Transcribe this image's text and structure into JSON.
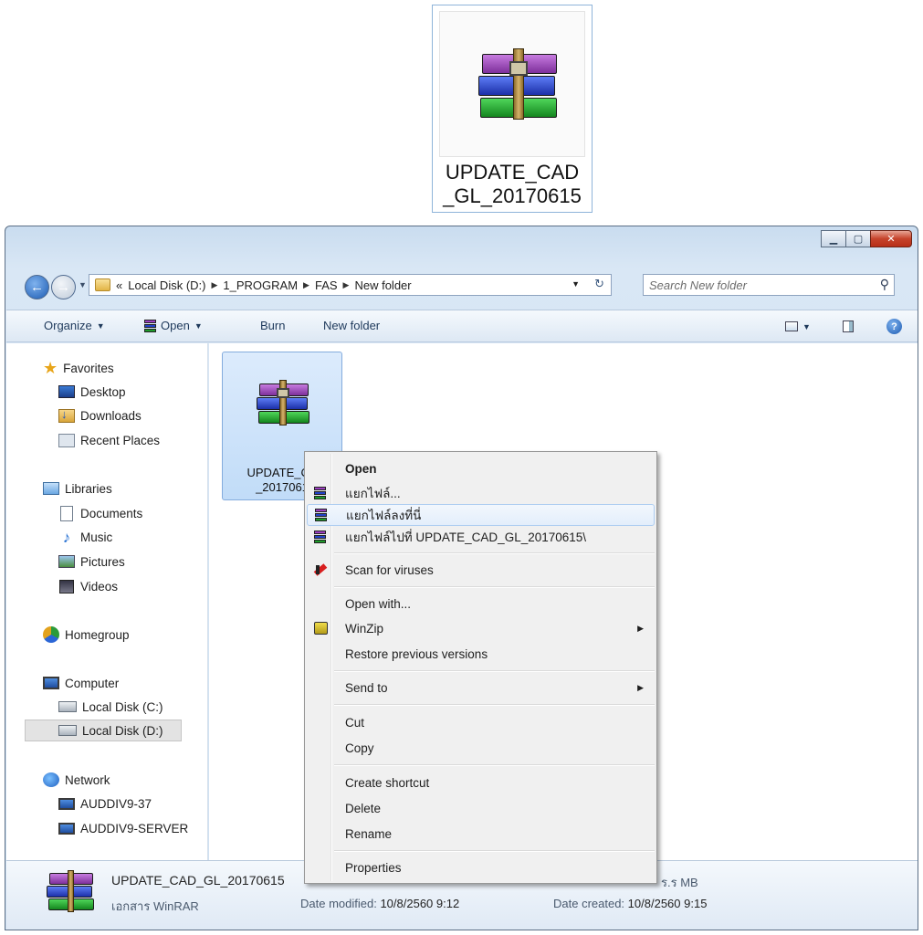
{
  "large_icon": {
    "name_line1": "UPDATE_CAD",
    "name_line2": "_GL_20170615"
  },
  "window": {
    "controls": {
      "minimize": "▁",
      "maximize": "▢",
      "close": "✕"
    }
  },
  "address": {
    "overflow": "«",
    "crumbs": [
      "Local Disk (D:)",
      "1_PROGRAM",
      "FAS",
      "New folder"
    ],
    "search_placeholder": "Search New folder"
  },
  "toolbar": {
    "organize": "Organize",
    "open": "Open",
    "burn": "Burn",
    "new_folder": "New folder"
  },
  "nav": {
    "favorites": "Favorites",
    "desktop": "Desktop",
    "downloads": "Downloads",
    "recent": "Recent Places",
    "libraries": "Libraries",
    "documents": "Documents",
    "music": "Music",
    "pictures": "Pictures",
    "videos": "Videos",
    "homegroup": "Homegroup",
    "computer": "Computer",
    "disk_c": "Local Disk (C:)",
    "disk_d": "Local Disk (D:)",
    "network": "Network",
    "pc1": "AUDDIV9-37",
    "pc2": "AUDDIV9-SERVER"
  },
  "file": {
    "name_line1": "UPDATE_CA",
    "name_line2": "_2017061"
  },
  "context_menu": {
    "open": "Open",
    "extract": "แยกไฟล์...",
    "extract_here": "แยกไฟล์ลงที่นี่",
    "extract_to": "แยกไฟล์ไปที่ UPDATE_CAD_GL_20170615\\",
    "scan": "Scan for viruses",
    "open_with": "Open with...",
    "winzip": "WinZip",
    "restore": "Restore previous versions",
    "send_to": "Send to",
    "cut": "Cut",
    "copy": "Copy",
    "create_shortcut": "Create shortcut",
    "delete": "Delete",
    "rename": "Rename",
    "properties": "Properties"
  },
  "details": {
    "name": "UPDATE_CAD_GL_20170615",
    "type": "เอกสาร WinRAR",
    "date_modified_label": "Date modified:",
    "date_modified": "10/8/2560 9:12",
    "date_created_label": "Date created:",
    "date_created": "10/8/2560 9:15",
    "size_partial": "ร.ร MB"
  }
}
